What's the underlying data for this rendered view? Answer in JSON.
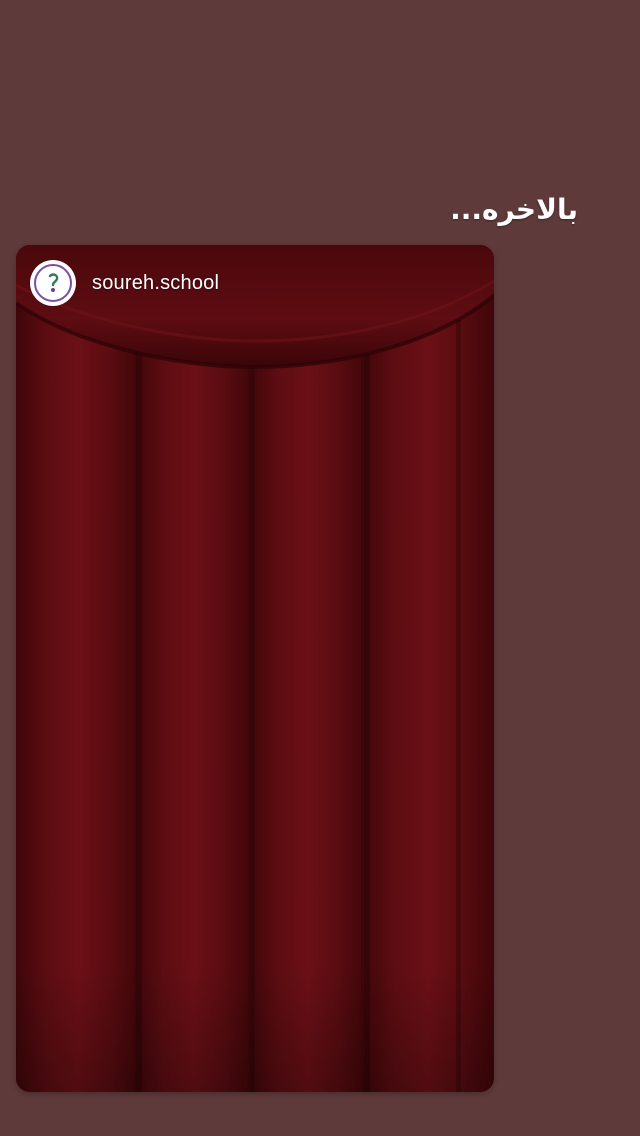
{
  "story": {
    "caption": "بالاخره...",
    "username": "soureh.school",
    "avatar_icon": "school-logo-icon"
  },
  "colors": {
    "background": "#5f3a3a",
    "curtain": "#5a0c10",
    "caption_text": "#ffffff"
  }
}
